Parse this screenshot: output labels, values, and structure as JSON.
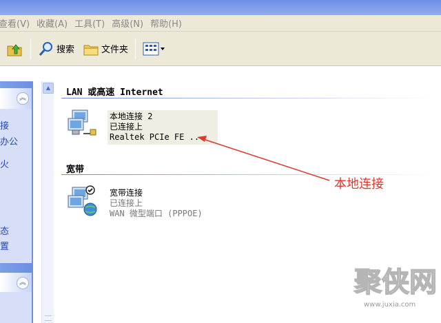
{
  "menubar": {
    "items": [
      "查看(V)",
      "收藏(A)",
      "工具(T)",
      "高级(N)",
      "帮助(H)"
    ]
  },
  "toolbar": {
    "search_label": "搜索",
    "folders_label": "文件夹"
  },
  "taskpane": {
    "links": [
      "接",
      "办公",
      "火",
      "态",
      "置"
    ]
  },
  "groups": {
    "lan": {
      "header": "LAN 或高速 Internet",
      "connection": {
        "name": "本地连接 2",
        "status": "已连接上",
        "device": "Realtek PCIe FE ..."
      }
    },
    "broadband": {
      "header": "宽带",
      "connection": {
        "name": "宽带连接",
        "status": "已连接上",
        "device": "WAN 微型端口 (PPPOE)"
      }
    }
  },
  "annotation": {
    "label": "本地连接",
    "color": "#d83b30"
  },
  "watermark": {
    "logo_text": "聚侠网",
    "url": "www.juxia.com"
  },
  "colors": {
    "menubar_bg": "#ece9d8",
    "taskpane_bg": "#7b9ee8",
    "group_header_line": "#6d8ad6"
  }
}
